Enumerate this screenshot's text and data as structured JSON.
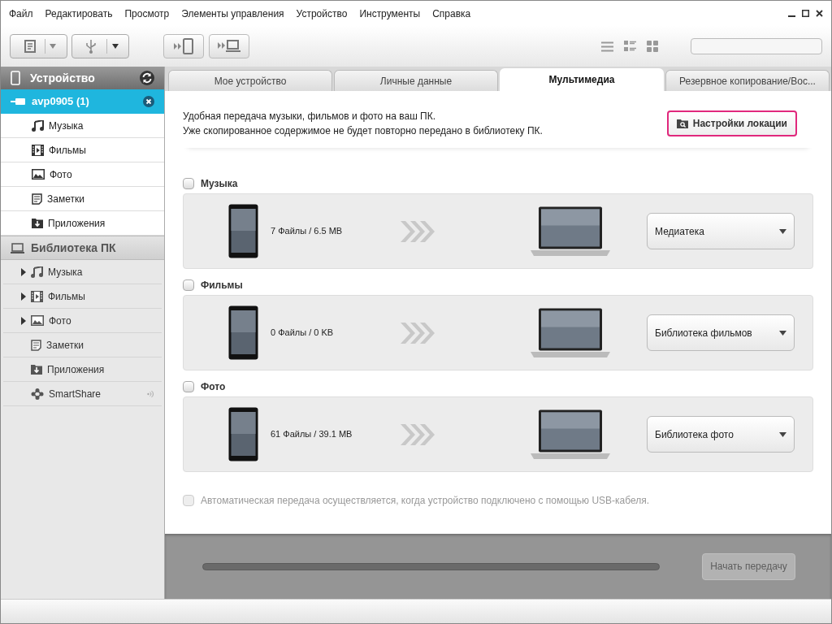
{
  "menu": [
    "Файл",
    "Редактировать",
    "Просмотр",
    "Элементы управления",
    "Устройство",
    "Инструменты",
    "Справка"
  ],
  "sidebar": {
    "device_header": "Устройство",
    "device": {
      "label": "avp0905 (1)",
      "selected": true
    },
    "device_items": [
      {
        "kind": "music",
        "label": "Музыка"
      },
      {
        "kind": "video",
        "label": "Фильмы"
      },
      {
        "kind": "photo",
        "label": "Фото"
      },
      {
        "kind": "notes",
        "label": "Заметки"
      },
      {
        "kind": "apps",
        "label": "Приложения"
      }
    ],
    "library_header": "Библиотека ПК",
    "library_items": [
      {
        "kind": "music",
        "label": "Музыка",
        "expanded": false
      },
      {
        "kind": "video",
        "label": "Фильмы",
        "expanded": false
      },
      {
        "kind": "photo",
        "label": "Фото",
        "expanded": false
      },
      {
        "kind": "notes",
        "label": "Заметки"
      },
      {
        "kind": "apps",
        "label": "Приложения"
      },
      {
        "kind": "share",
        "label": "SmartShare"
      }
    ]
  },
  "tabs": [
    {
      "label": "Мое устройство",
      "selected": false
    },
    {
      "label": "Личные данные",
      "selected": false
    },
    {
      "label": "Мультимедиа",
      "selected": true
    },
    {
      "label": "Резервное копирование/Вос...",
      "selected": false
    }
  ],
  "intro": [
    "Удобная передача музыки, фильмов и фото на ваш ПК.",
    "Уже скопированное содержимое не будет повторно передано в библиотеку ПК."
  ],
  "location_button": "Настройки локации",
  "categories": [
    {
      "label": "Музыка",
      "checked": false,
      "info": "7 Файлы / 6.5 MB",
      "destination": "Медиатека"
    },
    {
      "label": "Фильмы",
      "checked": false,
      "info": "0 Файлы / 0 KB",
      "destination": "Библиотека фильмов"
    },
    {
      "label": "Фото",
      "checked": false,
      "info": "61 Файлы / 39.1 MB",
      "destination": "Библиотека фото"
    }
  ],
  "auto_transfer": {
    "label": "Автоматическая передача осуществляется, когда устройство подключено с помощью USB-кабеля.",
    "checked": false,
    "disabled": true
  },
  "progress": {
    "level": 0
  },
  "start_button": {
    "label": "Начать передачу",
    "disabled": true
  }
}
